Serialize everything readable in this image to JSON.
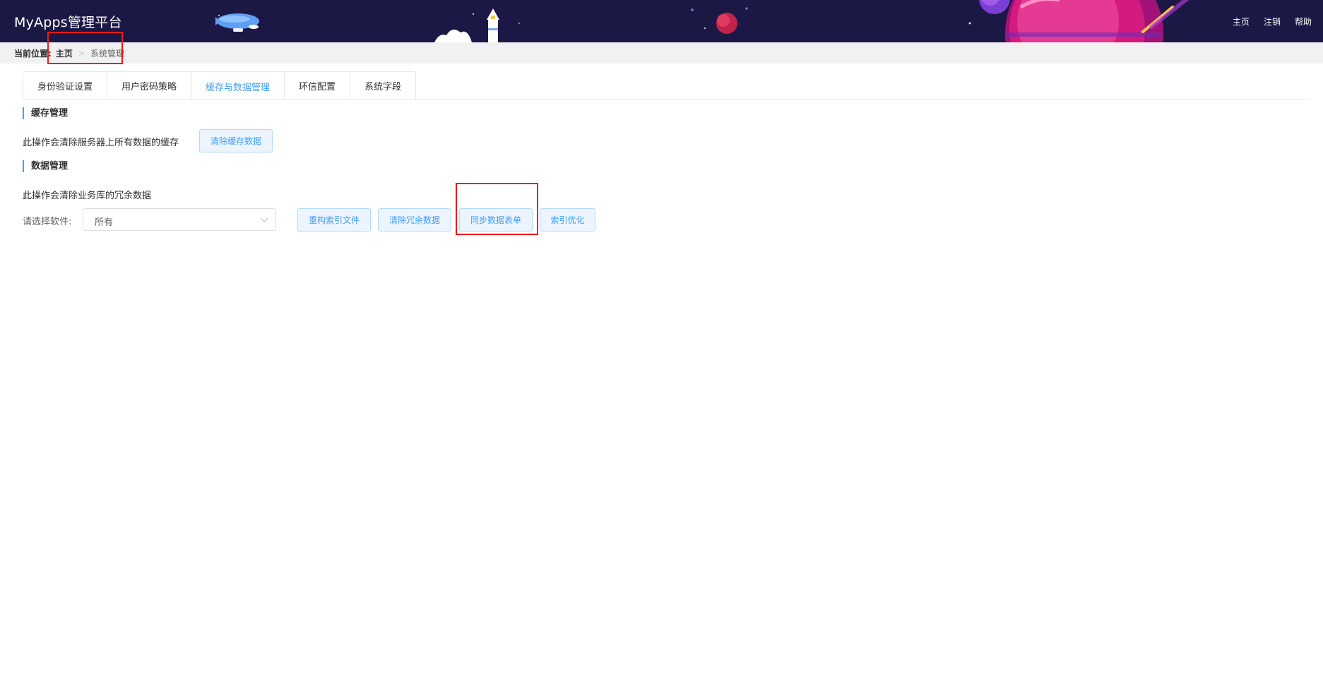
{
  "app": {
    "title": "MyApps管理平台"
  },
  "top_nav": {
    "home": "主页",
    "logout": "注销",
    "help": "帮助"
  },
  "breadcrumb": {
    "label": "当前位置:",
    "home": "主页",
    "separator": ">",
    "current": "系统管理"
  },
  "tabs": [
    {
      "label": "身份验证设置",
      "active": false
    },
    {
      "label": "用户密码策略",
      "active": false
    },
    {
      "label": "缓存与数据管理",
      "active": true
    },
    {
      "label": "环信配置",
      "active": false
    },
    {
      "label": "系统字段",
      "active": false
    }
  ],
  "cache_section": {
    "title": "缓存管理",
    "description": "此操作会清除服务器上所有数据的缓存",
    "clear_button": "清除缓存数据"
  },
  "data_section": {
    "title": "数据管理",
    "description": "此操作会清除业务库的冗余数据",
    "select_label": "请选择软件:",
    "select_value": "所有",
    "buttons": {
      "rebuild_index": "重构索引文件",
      "clear_redundant": "清除冗余数据",
      "sync_forms": "同步数据表单",
      "optimize_index": "索引优化"
    }
  },
  "colors": {
    "header_bg": "#1c1845",
    "accent": "#409eff",
    "annotation": "#ee1a1a"
  }
}
